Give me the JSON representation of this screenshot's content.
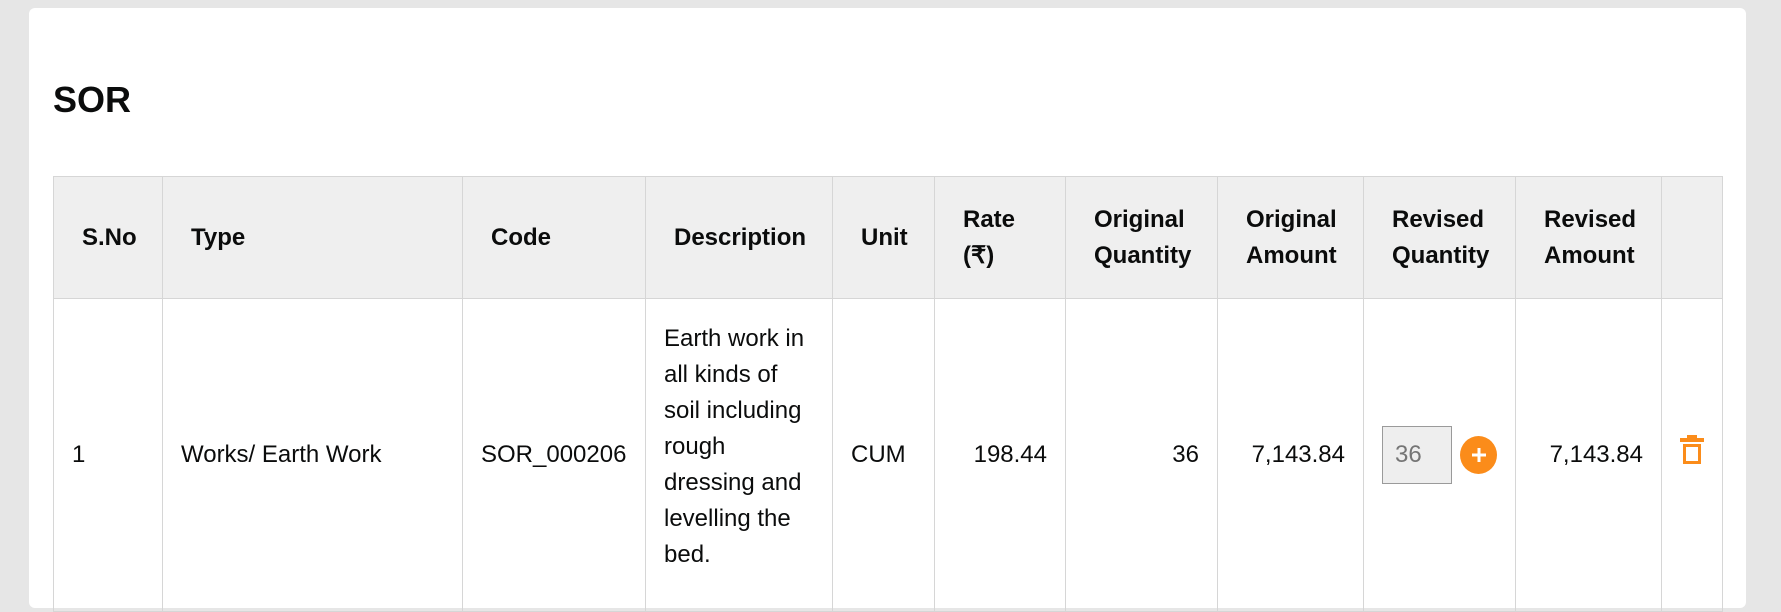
{
  "section": {
    "title": "SOR"
  },
  "table": {
    "headers": [
      "S.No",
      "Type",
      "Code",
      "Description",
      "Unit",
      "Rate (₹)",
      "Original Quantity",
      "Original Amount",
      "Revised Quantity",
      "Revised Amount",
      ""
    ],
    "rows": [
      {
        "sno": "1",
        "type": "Works/ Earth Work",
        "code": "SOR_000206",
        "description": "Earth work in all kinds of soil including rough dressing and levelling the bed.",
        "unit": "CUM",
        "rate": "198.44",
        "original_quantity": "36",
        "original_amount": "7,143.84",
        "revised_quantity_placeholder": "36",
        "revised_amount": "7,143.84"
      }
    ]
  },
  "icons": {
    "add": "plus-icon",
    "delete": "trash-icon"
  },
  "colors": {
    "accent": "#fb8c1a",
    "header_bg": "#efefef",
    "border": "#d6d6d6"
  }
}
